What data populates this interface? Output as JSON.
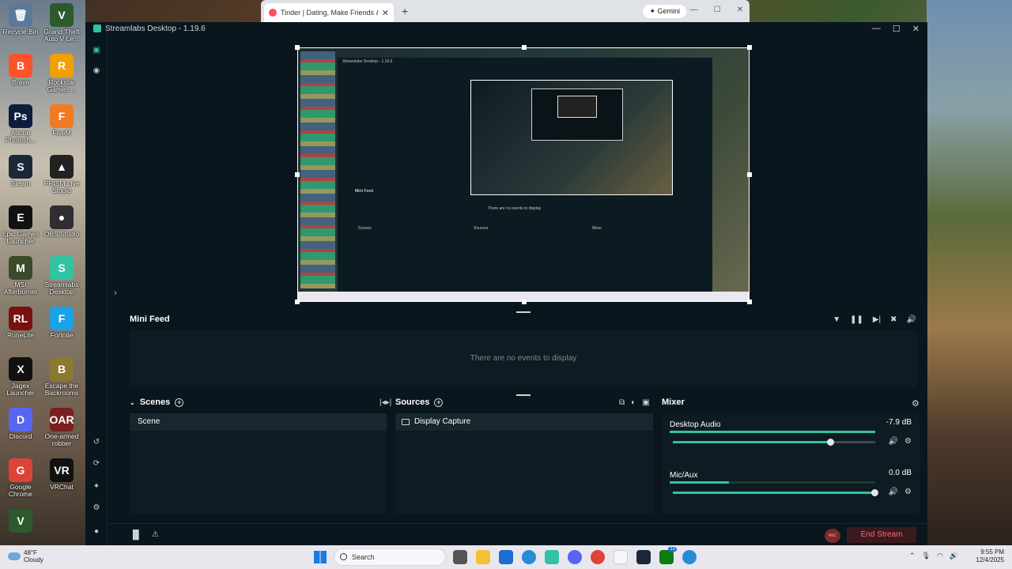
{
  "desktop": {
    "icons": [
      {
        "label": "Recycle Bin",
        "glyph": "🗑",
        "color": "#5a7a9a"
      },
      {
        "label": "Grand Theft Auto V Le...",
        "glyph": "V",
        "color": "#2d5a2d"
      },
      {
        "label": "Brave",
        "glyph": "B",
        "color": "#fb542b"
      },
      {
        "label": "Rockstar Games ...",
        "glyph": "R",
        "color": "#f0a000"
      },
      {
        "label": "Adobe Photosh...",
        "glyph": "Ps",
        "color": "#0d1d3b"
      },
      {
        "label": "FiveM",
        "glyph": "F",
        "color": "#f07b24"
      },
      {
        "label": "Steam",
        "glyph": "S",
        "color": "#1b2838"
      },
      {
        "label": "PRISM Live Studio",
        "glyph": "▲",
        "color": "#222"
      },
      {
        "label": "Epic Games Launcher",
        "glyph": "E",
        "color": "#111"
      },
      {
        "label": "OBS Studio",
        "glyph": "●",
        "color": "#302e31"
      },
      {
        "label": "MSI Afterburner",
        "glyph": "M",
        "color": "#3a4a2a"
      },
      {
        "label": "Streamlabs Desktop",
        "glyph": "S",
        "color": "#31c3a2"
      },
      {
        "label": "RuneLite",
        "glyph": "RL",
        "color": "#7a1010"
      },
      {
        "label": "Fortnite",
        "glyph": "F",
        "color": "#1aa3e8"
      },
      {
        "label": "Jagex Launcher",
        "glyph": "X",
        "color": "#111"
      },
      {
        "label": "Escape the Backrooms",
        "glyph": "B",
        "color": "#8a7a30"
      },
      {
        "label": "Discord",
        "glyph": "D",
        "color": "#5865f2"
      },
      {
        "label": "One-armed robber",
        "glyph": "OAR",
        "color": "#7a2020"
      },
      {
        "label": "Google Chrome",
        "glyph": "G",
        "color": "#db4437"
      },
      {
        "label": "VRChat",
        "glyph": "VR",
        "color": "#111"
      },
      {
        "label": "",
        "glyph": "V",
        "color": "#2d5a2d"
      }
    ]
  },
  "browser": {
    "tab_title": "Tinder | Dating, Make Friends &",
    "close": "✕",
    "new_tab": "+",
    "gemini_label": "✦ Gemini"
  },
  "app": {
    "title": "Streamlabs Desktop - 1.19.6",
    "minimize": "—",
    "maximize": "☐",
    "close": "✕"
  },
  "preview": {
    "mini_title": "Streamlabs Desktop - 1.19.6",
    "mini_feed": "Mini Feed",
    "mini_empty": "There are no events to display",
    "mini_scenes": "Scenes",
    "mini_sources": "Sources",
    "mini_mixer": "Mixer"
  },
  "minifeed": {
    "title": "Mini Feed",
    "empty_text": "There are no events to display"
  },
  "scenes": {
    "title": "Scenes",
    "items": [
      "Scene"
    ]
  },
  "sources": {
    "title": "Sources",
    "items": [
      "Display Capture"
    ]
  },
  "mixer": {
    "title": "Mixer",
    "channels": [
      {
        "name": "Desktop Audio",
        "db": "-7.9 dB",
        "level": 0.78,
        "meter": 1.0
      },
      {
        "name": "Mic/Aux",
        "db": "0.0 dB",
        "level": 1.0,
        "meter": 0.29
      }
    ]
  },
  "footer": {
    "rec_label": "REC",
    "end_stream": "End Stream"
  },
  "taskbar": {
    "weather_temp": "48°F",
    "weather_desc": "Cloudy",
    "search_placeholder": "Search",
    "time": "9:55 PM",
    "date": "12/4/2025",
    "badge": "13"
  }
}
